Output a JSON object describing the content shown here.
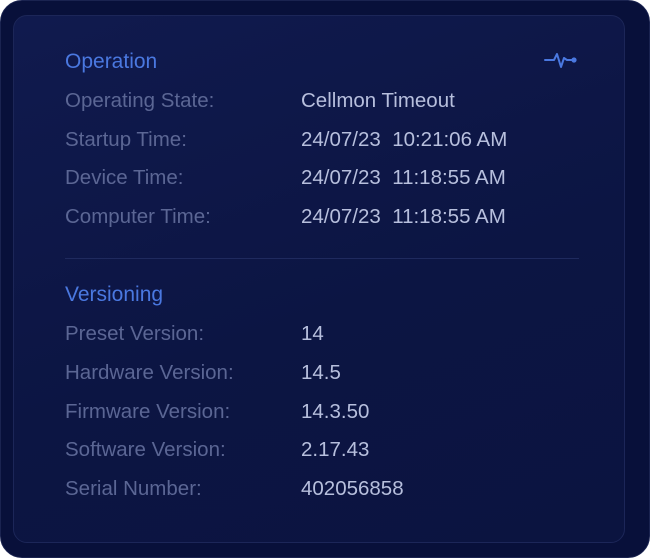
{
  "operation": {
    "title": "Operation",
    "rows": [
      {
        "label": "Operating State:",
        "value": "Cellmon Timeout"
      },
      {
        "label": "Startup Time:",
        "value": "24/07/23  10:21:06 AM"
      },
      {
        "label": "Device Time:",
        "value": "24/07/23  11:18:55 AM"
      },
      {
        "label": "Computer Time:",
        "value": "24/07/23  11:18:55 AM"
      }
    ],
    "icon": "activity-pulse-icon",
    "accent_color": "#4a78e0"
  },
  "versioning": {
    "title": "Versioning",
    "rows": [
      {
        "label": "Preset Version:",
        "value": "14"
      },
      {
        "label": "Hardware Version:",
        "value": "14.5"
      },
      {
        "label": "Firmware Version:",
        "value": "14.3.50"
      },
      {
        "label": "Software Version:",
        "value": "2.17.43"
      },
      {
        "label": "Serial Number:",
        "value": "402056858"
      }
    ]
  }
}
